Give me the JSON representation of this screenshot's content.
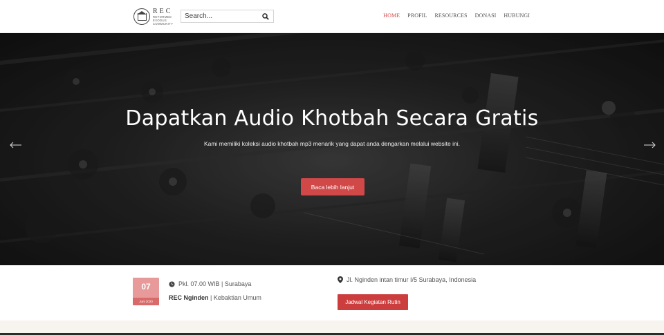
{
  "brand": {
    "mark": "REC",
    "subtitle_lines": [
      "REFORMED",
      "EXODUS",
      "COMMUNITY"
    ]
  },
  "search": {
    "placeholder": "Search..."
  },
  "nav": {
    "items": [
      "HOME",
      "PROFIL",
      "RESOURCES",
      "DONASI",
      "HUBUNGI"
    ],
    "active": "HOME"
  },
  "hero": {
    "title": "Dapatkan Audio Khotbah Secara Gratis",
    "subtitle": "Kami memiliki koleksi audio khotbah mp3 menarik yang dapat anda dengarkan melalui website ini.",
    "button": "Baca lebih lanjut"
  },
  "event": {
    "day": "07",
    "month": "Juni 2020",
    "time": "Pkl. 07.00 WIB | Surabaya",
    "place": "REC Nginden",
    "category": "Kebaktian Umum",
    "location": "Jl. Nginden intan timur I/5 Surabaya, Indonesia",
    "button": "Jadwal Kegiatan Rutin"
  },
  "colors": {
    "accent": "#d04848",
    "date_box": "#e89a9a",
    "nav_active": "#d34b4b"
  }
}
